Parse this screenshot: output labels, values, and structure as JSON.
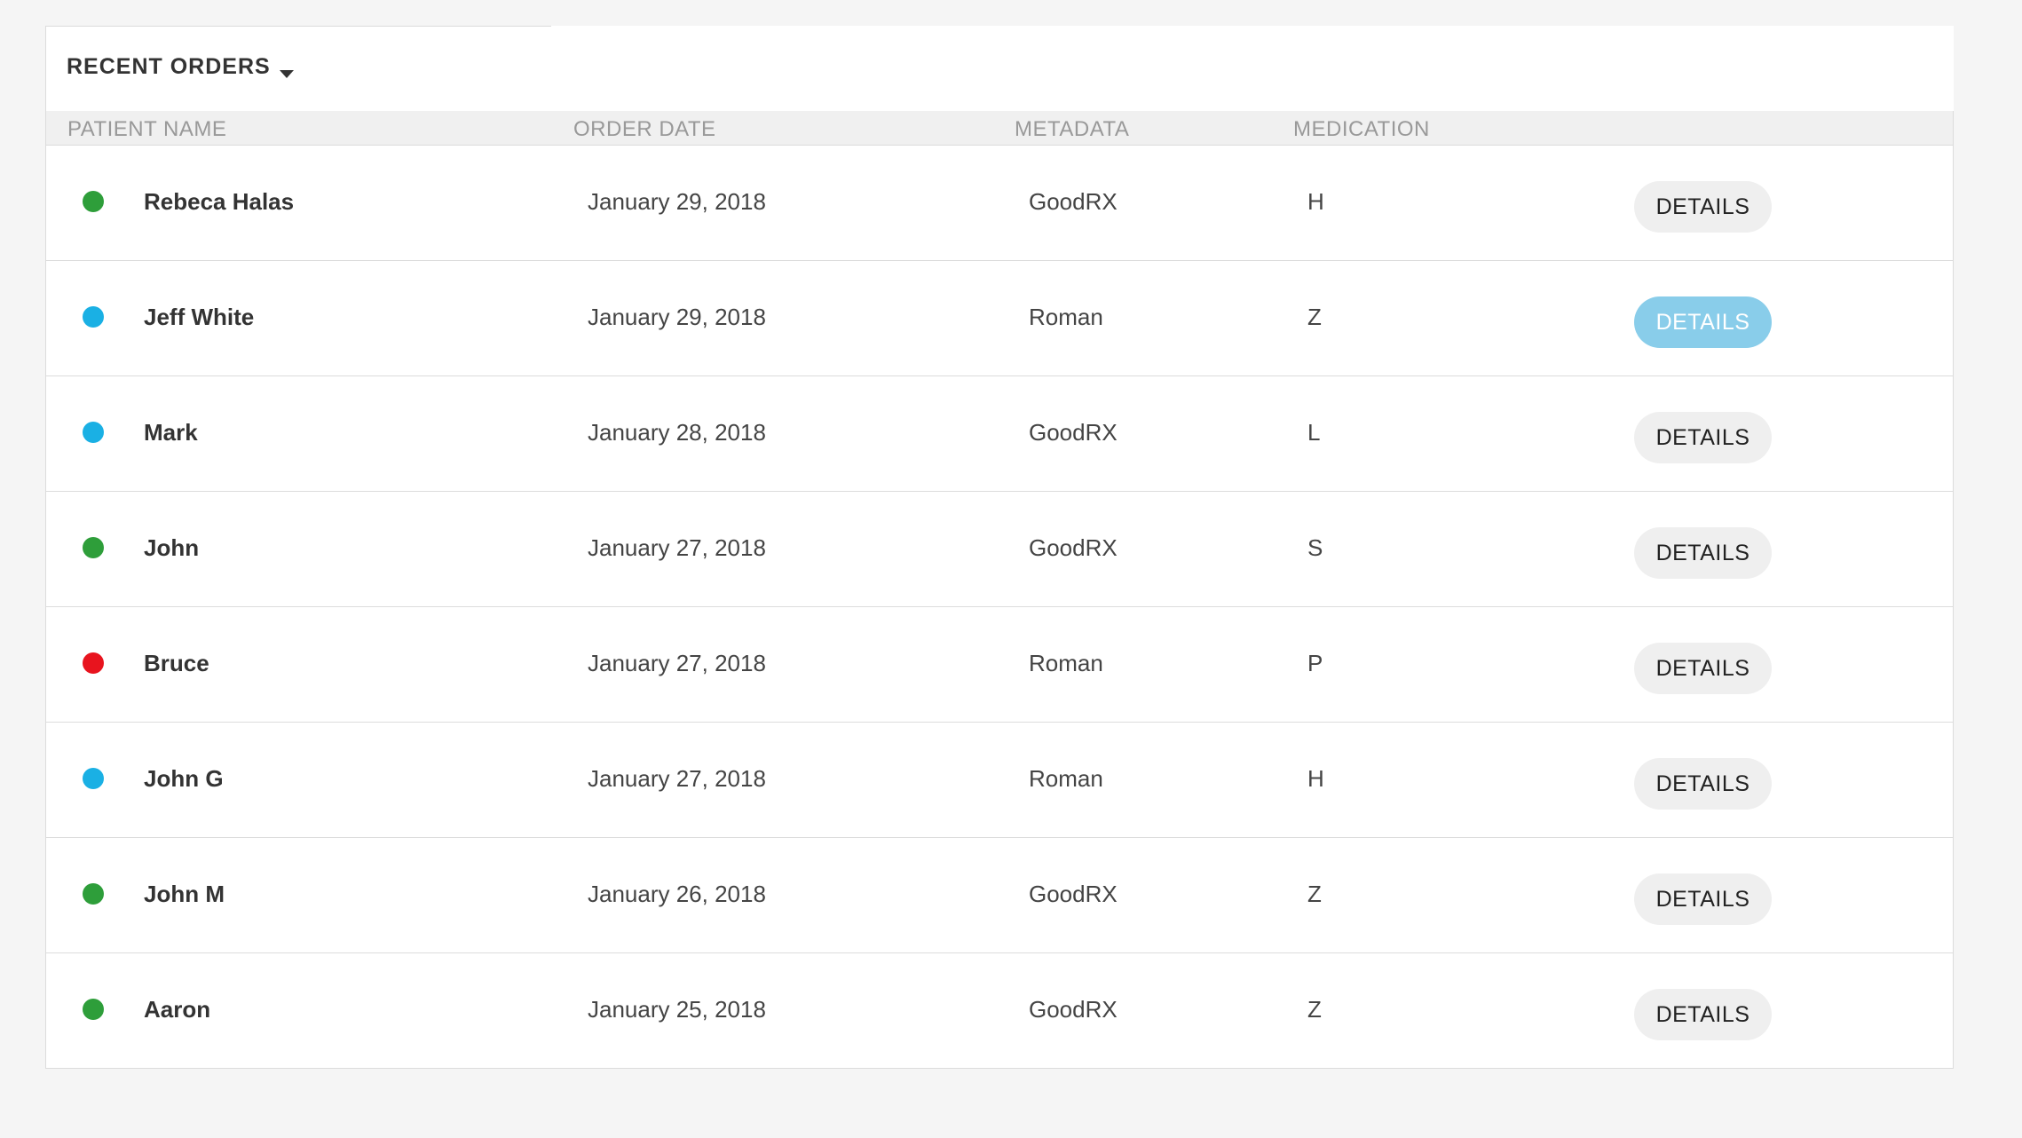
{
  "header": {
    "dropdown_label": "RECENT ORDERS"
  },
  "columns": {
    "patient_name": "PATIENT NAME",
    "order_date": "ORDER DATE",
    "metadata": "METADATA",
    "medication": "MEDICATION"
  },
  "status_colors": {
    "green": "#2e9e3a",
    "blue": "#1ab0e4",
    "red": "#e8141e"
  },
  "rows": [
    {
      "status": "green",
      "name": "Rebeca Halas",
      "date": "January 29, 2018",
      "metadata": "GoodRX",
      "medication": "H",
      "action": "DETAILS",
      "active": false
    },
    {
      "status": "blue",
      "name": "Jeff White",
      "date": "January 29, 2018",
      "metadata": "Roman",
      "medication": "Z",
      "action": "DETAILS",
      "active": true
    },
    {
      "status": "blue",
      "name": "Mark",
      "date": "January 28, 2018",
      "metadata": "GoodRX",
      "medication": "L",
      "action": "DETAILS",
      "active": false
    },
    {
      "status": "green",
      "name": "John",
      "date": "January 27, 2018",
      "metadata": "GoodRX",
      "medication": "S",
      "action": "DETAILS",
      "active": false
    },
    {
      "status": "red",
      "name": "Bruce",
      "date": "January 27, 2018",
      "metadata": "Roman",
      "medication": "P",
      "action": "DETAILS",
      "active": false
    },
    {
      "status": "blue",
      "name": "John G",
      "date": "January 27, 2018",
      "metadata": "Roman",
      "medication": "H",
      "action": "DETAILS",
      "active": false
    },
    {
      "status": "green",
      "name": "John M",
      "date": "January 26, 2018",
      "metadata": "GoodRX",
      "medication": "Z",
      "action": "DETAILS",
      "active": false
    },
    {
      "status": "green",
      "name": "Aaron",
      "date": "January 25, 2018",
      "metadata": "GoodRX",
      "medication": "Z",
      "action": "DETAILS",
      "active": false
    }
  ]
}
